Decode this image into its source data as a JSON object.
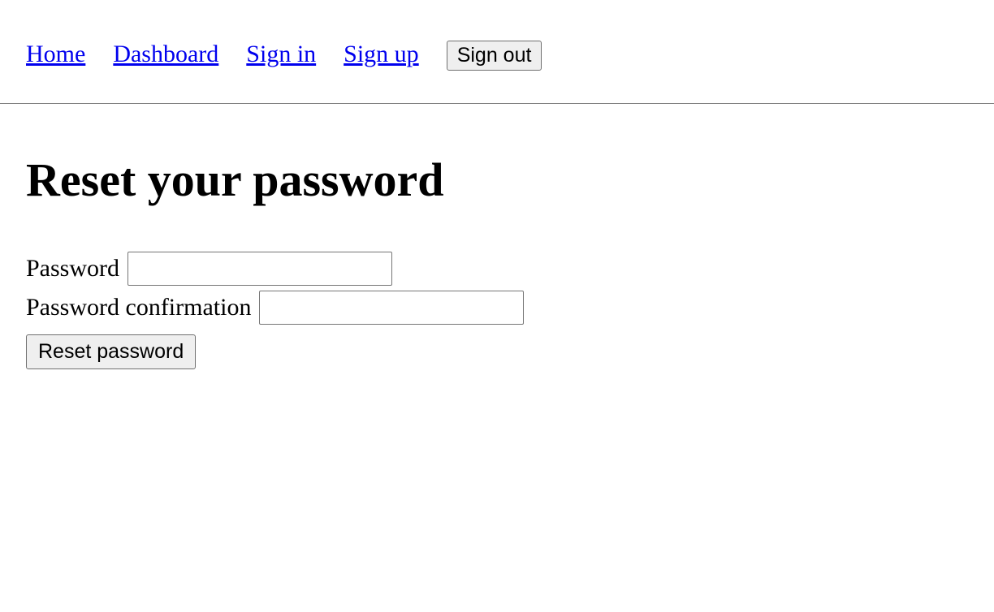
{
  "nav": {
    "home": "Home",
    "dashboard": "Dashboard",
    "signin": "Sign in",
    "signup": "Sign up",
    "signout": "Sign out"
  },
  "page": {
    "title": "Reset your password"
  },
  "form": {
    "password_label": "Password",
    "password_value": "",
    "password_confirmation_label": "Password confirmation",
    "password_confirmation_value": "",
    "submit_label": "Reset password"
  }
}
